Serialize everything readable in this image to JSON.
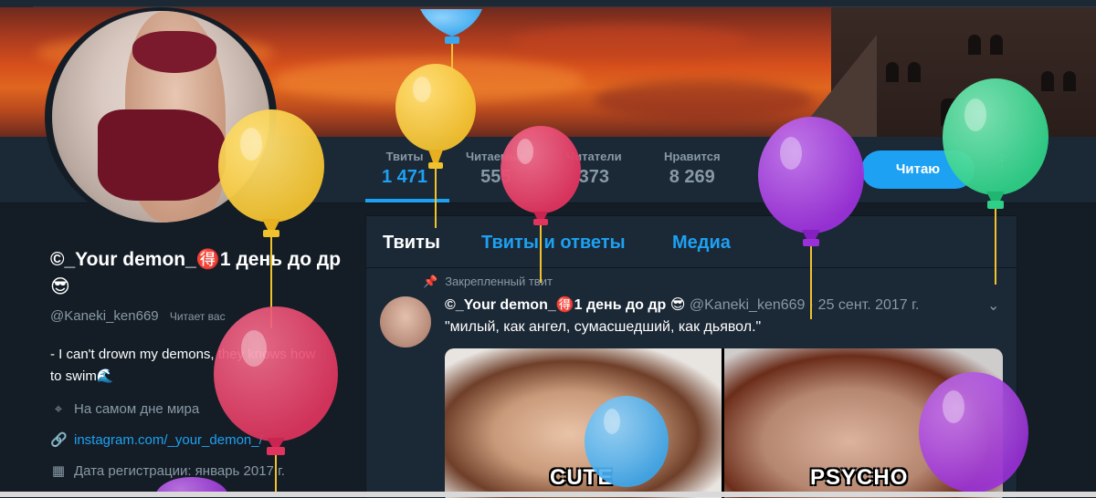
{
  "stats": [
    {
      "label": "Твиты",
      "value": "1 471",
      "active": true
    },
    {
      "label": "Читаемые",
      "value": "555"
    },
    {
      "label": "Читатели",
      "value": "373"
    },
    {
      "label": "Нравится",
      "value": "8 269"
    }
  ],
  "follow_button": "Читаю",
  "profile": {
    "name": "©_Your demon_🉐1 день до др 😎",
    "handle": "@Kaneki_ken669",
    "follows_you": "Читает вас",
    "bio": "- I can't drown my demons, they knows how to swim🌊",
    "location": "На самом дне мира",
    "link": "instagram.com/_your_demon_/",
    "joined": "Дата регистрации: январь 2017 г."
  },
  "tabs": [
    "Твиты",
    "Твиты и ответы",
    "Медиа"
  ],
  "pinned_label": "Закрепленный твит",
  "tweet": {
    "name": "©_Your demon_🉐1 день до др 😎",
    "handle": "@Kaneki_ken669",
    "date": "· 25 сент. 2017 г.",
    "text": "\"милый, как ангел, сумасшедший, как дьявол.\"",
    "captions": [
      "CUTE",
      "PSYCHO"
    ]
  },
  "balloon_colors": {
    "yellow": "#f2c12e",
    "red": "#e0345e",
    "purple": "#9b30d9",
    "green": "#2ecf86",
    "blue": "#3aa8ef"
  },
  "colors": {
    "background": "#141d26",
    "panel": "#1b2836",
    "accent": "#1da1f2",
    "muted": "#8899a6"
  }
}
